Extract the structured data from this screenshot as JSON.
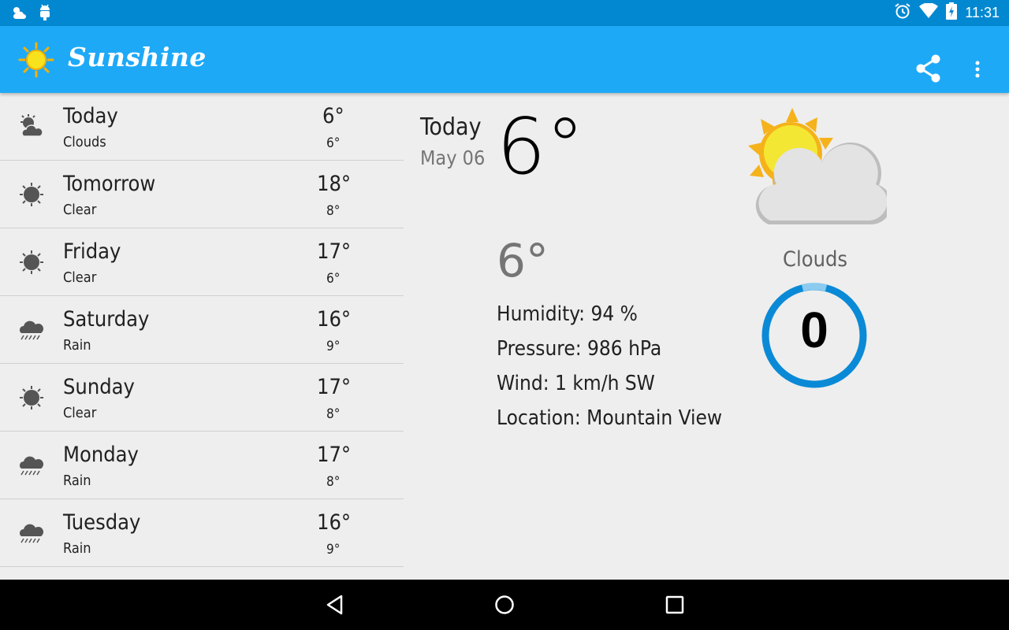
{
  "status_bar": {
    "time": "11:31",
    "left_icons": [
      "weather-notification-icon",
      "android-debug-icon"
    ],
    "right_icons": [
      "alarm-icon",
      "wifi-icon",
      "battery-charging-icon"
    ]
  },
  "app_bar": {
    "title": "Sunshine",
    "logo_icon": "sun-logo-icon",
    "actions": [
      "share-icon",
      "overflow-menu-icon"
    ]
  },
  "forecast": [
    {
      "day": "Today",
      "desc": "Clouds",
      "high": "6°",
      "low": "6°",
      "icon": "clouds-icon"
    },
    {
      "day": "Tomorrow",
      "desc": "Clear",
      "high": "18°",
      "low": "8°",
      "icon": "clear-icon"
    },
    {
      "day": "Friday",
      "desc": "Clear",
      "high": "17°",
      "low": "6°",
      "icon": "clear-icon"
    },
    {
      "day": "Saturday",
      "desc": "Rain",
      "high": "16°",
      "low": "9°",
      "icon": "rain-icon"
    },
    {
      "day": "Sunday",
      "desc": "Clear",
      "high": "17°",
      "low": "8°",
      "icon": "clear-icon"
    },
    {
      "day": "Monday",
      "desc": "Rain",
      "high": "17°",
      "low": "8°",
      "icon": "rain-icon"
    },
    {
      "day": "Tuesday",
      "desc": "Rain",
      "high": "16°",
      "low": "9°",
      "icon": "rain-icon"
    }
  ],
  "detail": {
    "day": "Today",
    "date": "May 06",
    "high": "6°",
    "low": "6°",
    "humidity": "Humidity: 94 %",
    "pressure": "Pressure: 986 hPa",
    "wind": "Wind: 1 km/h SW",
    "location": "Location: Mountain View",
    "condition": "Clouds",
    "condition_icon": "clouds-color-icon",
    "gauge_value": "0",
    "gauge_color": "#0a8ad6"
  },
  "colors": {
    "status_bar": "#0288d1",
    "app_bar": "#1ea9f7",
    "background": "#eeeeee"
  },
  "nav_bar": {
    "buttons": [
      "back-icon",
      "home-icon",
      "recents-icon"
    ]
  }
}
